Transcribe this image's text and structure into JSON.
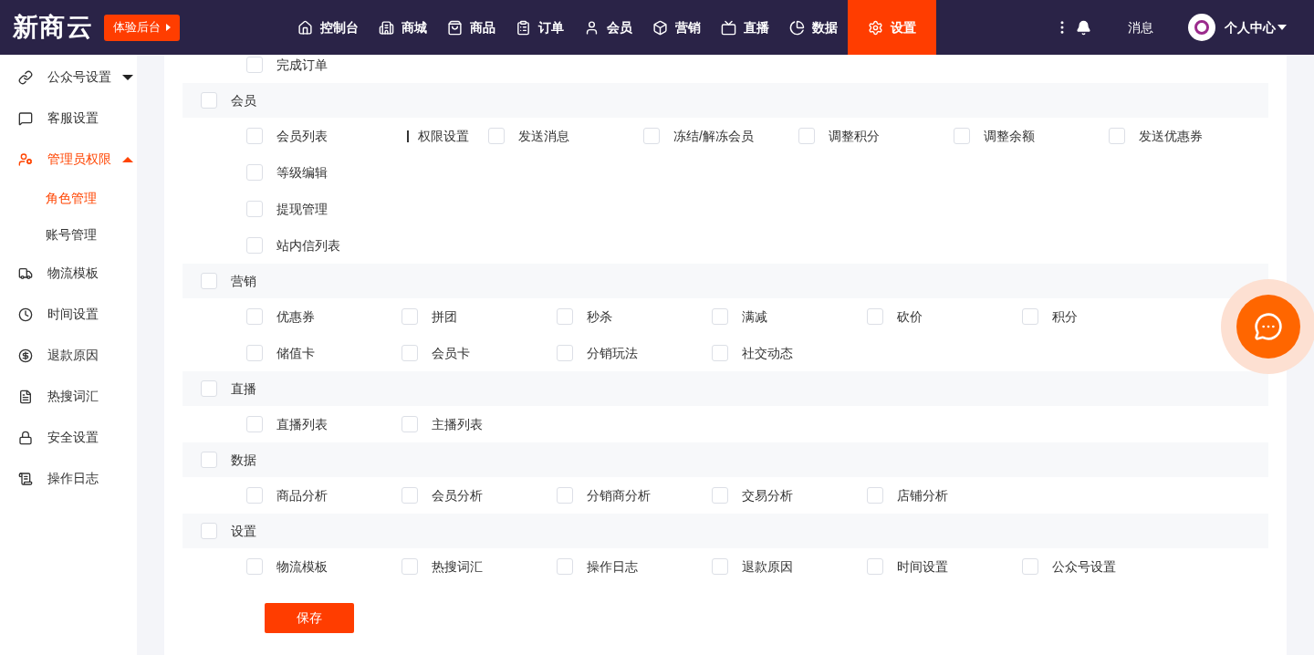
{
  "header": {
    "logo": "新商云",
    "trial_button": "体验后台",
    "nav": [
      {
        "label": "控制台",
        "selected": false
      },
      {
        "label": "商城",
        "selected": false
      },
      {
        "label": "商品",
        "selected": false
      },
      {
        "label": "订单",
        "selected": false
      },
      {
        "label": "会员",
        "selected": false
      },
      {
        "label": "营销",
        "selected": false
      },
      {
        "label": "直播",
        "selected": false
      },
      {
        "label": "数据",
        "selected": false
      },
      {
        "label": "设置",
        "selected": true
      }
    ],
    "messages": "消息",
    "user_menu": "个人中心"
  },
  "sidebar": {
    "items": [
      {
        "label": "公众号设置",
        "selected": false,
        "expanded": false
      },
      {
        "label": "客服设置",
        "selected": false
      },
      {
        "label": "管理员权限",
        "selected": true,
        "expanded": true,
        "children": [
          {
            "label": "角色管理",
            "selected": true
          },
          {
            "label": "账号管理",
            "selected": false
          }
        ]
      },
      {
        "label": "物流模板",
        "selected": false
      },
      {
        "label": "时间设置",
        "selected": false
      },
      {
        "label": "退款原因",
        "selected": false
      },
      {
        "label": "热搜词汇",
        "selected": false
      },
      {
        "label": "安全设置",
        "selected": false
      },
      {
        "label": "操作日志",
        "selected": false
      }
    ]
  },
  "permissions": [
    {
      "rows": [
        [
          {
            "kind": "checkbox",
            "label": "完成订单",
            "checked": false
          }
        ]
      ]
    },
    {
      "title": "会员",
      "checked": false,
      "rows": [
        [
          {
            "kind": "checkbox",
            "label": "会员列表",
            "checked": false
          },
          {
            "kind": "bar",
            "label": "权限设置"
          },
          {
            "kind": "checkbox",
            "label": "发送消息",
            "checked": false
          },
          {
            "kind": "checkbox",
            "label": "冻结/解冻会员",
            "checked": false
          },
          {
            "kind": "checkbox",
            "label": "调整积分",
            "checked": false
          },
          {
            "kind": "checkbox",
            "label": "调整余额",
            "checked": false
          },
          {
            "kind": "checkbox",
            "label": "发送优惠券",
            "checked": false
          }
        ],
        [
          {
            "kind": "checkbox",
            "label": "等级编辑",
            "checked": false
          }
        ],
        [
          {
            "kind": "checkbox",
            "label": "提现管理",
            "checked": false
          }
        ],
        [
          {
            "kind": "checkbox",
            "label": "站内信列表",
            "checked": false
          }
        ]
      ]
    },
    {
      "title": "营销",
      "checked": false,
      "rows": [
        [
          {
            "kind": "checkbox",
            "label": "优惠券",
            "checked": false
          },
          {
            "kind": "checkbox",
            "label": "拼团",
            "checked": false
          },
          {
            "kind": "checkbox",
            "label": "秒杀",
            "checked": false
          },
          {
            "kind": "checkbox",
            "label": "满减",
            "checked": false
          },
          {
            "kind": "checkbox",
            "label": "砍价",
            "checked": false
          },
          {
            "kind": "checkbox",
            "label": "积分",
            "checked": false
          }
        ],
        [
          {
            "kind": "checkbox",
            "label": "储值卡",
            "checked": false
          },
          {
            "kind": "checkbox",
            "label": "会员卡",
            "checked": false
          },
          {
            "kind": "checkbox",
            "label": "分销玩法",
            "checked": false
          },
          {
            "kind": "checkbox",
            "label": "社交动态",
            "checked": false
          }
        ]
      ]
    },
    {
      "title": "直播",
      "checked": false,
      "rows": [
        [
          {
            "kind": "checkbox",
            "label": "直播列表",
            "checked": false
          },
          {
            "kind": "checkbox",
            "label": "主播列表",
            "checked": false
          }
        ]
      ]
    },
    {
      "title": "数据",
      "checked": false,
      "rows": [
        [
          {
            "kind": "checkbox",
            "label": "商品分析",
            "checked": false
          },
          {
            "kind": "checkbox",
            "label": "会员分析",
            "checked": false
          },
          {
            "kind": "checkbox",
            "label": "分销商分析",
            "checked": false
          },
          {
            "kind": "checkbox",
            "label": "交易分析",
            "checked": false
          },
          {
            "kind": "checkbox",
            "label": "店铺分析",
            "checked": false
          }
        ]
      ]
    },
    {
      "title": "设置",
      "checked": false,
      "rows": [
        [
          {
            "kind": "checkbox",
            "label": "物流模板",
            "checked": false
          },
          {
            "kind": "checkbox",
            "label": "热搜词汇",
            "checked": false
          },
          {
            "kind": "checkbox",
            "label": "操作日志",
            "checked": false
          },
          {
            "kind": "checkbox",
            "label": "退款原因",
            "checked": false
          },
          {
            "kind": "checkbox",
            "label": "时间设置",
            "checked": false
          },
          {
            "kind": "checkbox",
            "label": "公众号设置",
            "checked": false
          }
        ]
      ]
    }
  ],
  "save_button": "保存"
}
